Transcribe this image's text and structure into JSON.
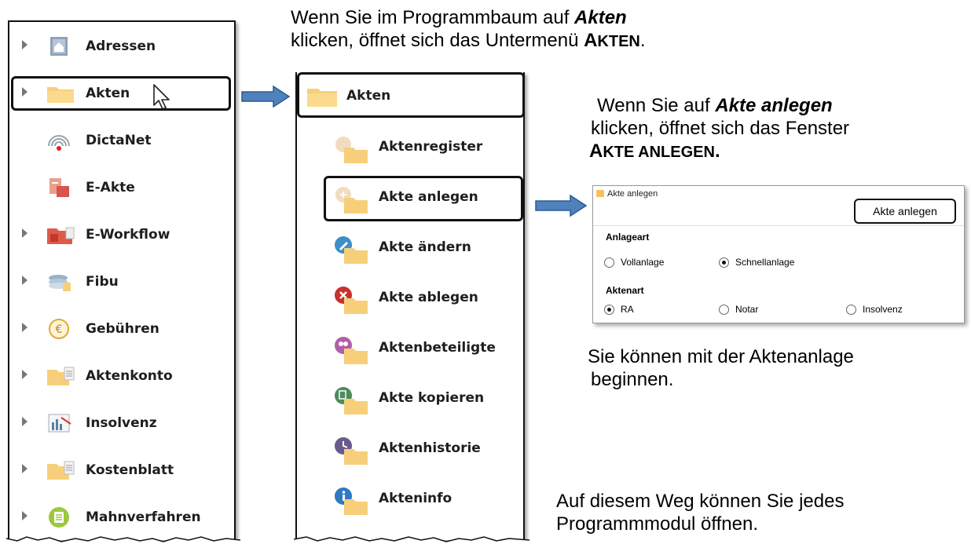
{
  "tree": {
    "items": [
      {
        "label": "Adressen",
        "icon": "addresses-icon"
      },
      {
        "label": "Akten",
        "icon": "folder-icon"
      },
      {
        "label": "DictaNet",
        "icon": "dictanet-icon"
      },
      {
        "label": "E-Akte",
        "icon": "e-akte-icon"
      },
      {
        "label": "E-Workflow",
        "icon": "e-workflow-icon"
      },
      {
        "label": "Fibu",
        "icon": "fibu-icon"
      },
      {
        "label": "Gebühren",
        "icon": "euro-icon"
      },
      {
        "label": "Aktenkonto",
        "icon": "aktenkonto-icon"
      },
      {
        "label": "Insolvenz",
        "icon": "insolvenz-icon"
      },
      {
        "label": "Kostenblatt",
        "icon": "kostenblatt-icon"
      },
      {
        "label": "Mahnverfahren",
        "icon": "mahnverfahren-icon"
      }
    ]
  },
  "submenu": {
    "header": "Akten",
    "items": [
      {
        "label": "Aktenregister",
        "icon": "aktenregister-icon"
      },
      {
        "label": "Akte anlegen",
        "icon": "akte-anlegen-icon"
      },
      {
        "label": "Akte ändern",
        "icon": "akte-aendern-icon"
      },
      {
        "label": "Akte ablegen",
        "icon": "akte-ablegen-icon"
      },
      {
        "label": "Aktenbeteiligte",
        "icon": "aktenbeteiligte-icon"
      },
      {
        "label": "Akte kopieren",
        "icon": "akte-kopieren-icon"
      },
      {
        "label": "Aktenhistorie",
        "icon": "aktenhistorie-icon"
      },
      {
        "label": "Akteninfo",
        "icon": "akteninfo-icon"
      }
    ]
  },
  "captions": {
    "top": {
      "l1a": "Wenn Sie im Programmbaum auf ",
      "l1b": "Akten",
      "l2a": "klicken, öffnet sich das Untermenü ",
      "l2b": "A",
      "l2c": "KTEN",
      "l2d": "."
    },
    "right": {
      "l1a": "Wenn Sie auf ",
      "l1b": "Akte anlegen",
      "l2": "klicken, öffnet sich das Fenster",
      "l3a": "A",
      "l3b": "KTE ANLEGEN",
      "l3c": "."
    },
    "begin": {
      "l1": "Sie können mit der Aktenanlage",
      "l2": "beginnen."
    },
    "bottom": {
      "l1": "Auf diesem Weg können Sie jedes",
      "l2": "Programmmodul öffnen."
    }
  },
  "dialog": {
    "title": "Akte anlegen",
    "button": "Akte anlegen",
    "anlageart_label": "Anlageart",
    "anlageart_options": [
      {
        "label": "Vollanlage",
        "selected": false
      },
      {
        "label": "Schnellanlage",
        "selected": true
      }
    ],
    "aktenart_label": "Aktenart",
    "aktenart_options": [
      {
        "label": "RA",
        "selected": true
      },
      {
        "label": "Notar",
        "selected": false
      },
      {
        "label": "Insolvenz",
        "selected": false
      }
    ]
  },
  "colors": {
    "folder": "#f7cf7a",
    "arrow": "#4f81bd",
    "arrow_stroke": "#2c5b8f"
  }
}
